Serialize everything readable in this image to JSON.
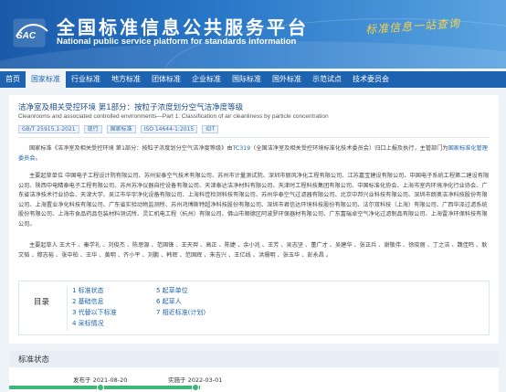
{
  "header": {
    "logo_text": "SAC",
    "title": "全国标准信息公共服务平台",
    "subtitle": "National public service platform  for standards information",
    "slogan": "标准信息一站查询"
  },
  "nav": {
    "items": [
      {
        "label": "首页",
        "active": false
      },
      {
        "label": "国家标准",
        "active": true
      },
      {
        "label": "行业标准",
        "active": false
      },
      {
        "label": "地方标准",
        "active": false
      },
      {
        "label": "团体标准",
        "active": false
      },
      {
        "label": "企业标准",
        "active": false
      },
      {
        "label": "国际标准",
        "active": false
      },
      {
        "label": "国外标准",
        "active": false
      },
      {
        "label": "示范试点",
        "active": false
      },
      {
        "label": "技术委员会",
        "active": false
      }
    ]
  },
  "standard": {
    "title": "洁净室及相关受控环境 第1部分：按粒子浓度划分空气洁净度等级",
    "subtitle_en": "Cleanrooms and associated controlled environments—Part 1: Classification of air cleanliness by particle concentration",
    "tags": [
      "GB/T 25915.1-2021",
      "现行",
      "国家标准",
      "ISO 14644-1:2015",
      "IDT"
    ],
    "intro": {
      "prefix": "国家标准《洁净室及相关受控环境 第1部分：按粒子浓度划分空气洁净度等级》由",
      "committee_code": "TC319",
      "committee_name": "（全国洁净室及相关受控环境标准化技术委员会）",
      "middle": "归口上报及执行，主管部门为",
      "authority": "国家标准化管理委员会",
      "suffix": "。"
    },
    "drafting_units": "主要起草单位 中国电子工程设计院有限公司、苏州安泰空气技术有限公司、苏州市计量测试院、深圳市丽风净化工程有限公司、江苏嘉宝建设有限公司、中国电子系统工程第二建设有限公司、陕西中电精泰电子工程有限公司、苏州苏净仪器自控设备有限公司、天津泰达洁净材料有限公司、天津时工程科技集团有限公司、中国标准化协会、上海市室内环境净化行业协会、广东省洁净技术行业协会、天津大学、吴江市华宇净化设备有限公司、上海科佳检测科技有限公司、苏州华泰空气过滤器有限公司、北京中邦兴业科技有限公司、深圳市朗奥洁净科技股份有限公司、上海置业净化科技有限公司、广东省实验动物监测所、苏州鸿博斯特超净科技股份有限公司、深圳市君信达环境科技股份有限公司、法尔双科技（上海）有限公司、广西华泽过滤系统股份有限公司、上海市食品药品包装材料测试所、灵汇机电工程（杭州）有限公司、佛山市顺德区阿波罗环保器材有限公司、广东富瑞卓空气净化过滤制品有限公司、上海雷净环保科技有限公司。",
    "drafters": "主要起草人 王大千 、秦学礼 、刘俊杰 、陈思源 、范国锋 、王天羿 、高正 、陈婕 、余小兆 、王芳 、吴志坚 、董广才 、吴建华 、张正兵 、谢敬伟 、徐晓丽 、丁之洁 、魏佳鸣 、耿文韬 、穆志裕 、张中柏 、王华 、黄明 、齐小平 、刘鹏 、韩辉 、范国辉 、朱吉兴 、王亿线 、洪珊明 、张玉华 、彭永昌 。"
  },
  "toc": {
    "label": "目录",
    "col1": [
      "1 标准状态",
      "2 基础信息",
      "3 代替以下标准",
      "4 采标情况"
    ],
    "col2": [
      "5 起草单位",
      "6 起草人",
      "7 相近标准(计划)"
    ]
  },
  "status": {
    "title": "标准状态",
    "published": "发布于 2021-08-20",
    "implemented": "实施于 2022-03-01",
    "progress": 0.39,
    "accent": "#3db67a"
  }
}
